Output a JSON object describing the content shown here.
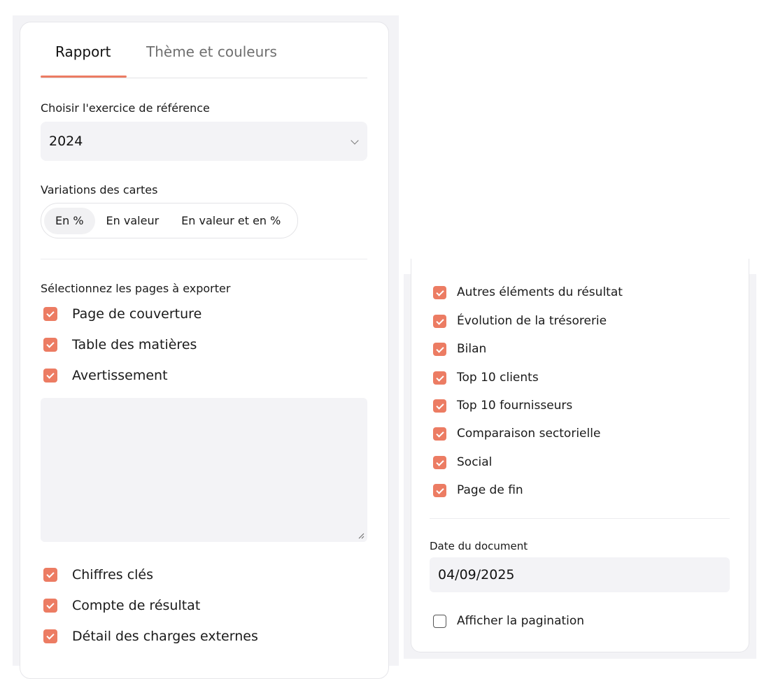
{
  "tabs": [
    {
      "label": "Rapport",
      "active": true
    },
    {
      "label": "Thème et couleurs",
      "active": false
    }
  ],
  "exercise": {
    "label": "Choisir l'exercice de référence",
    "value": "2024"
  },
  "variations": {
    "label": "Variations des cartes",
    "options": [
      "En %",
      "En valeur",
      "En valeur et en %"
    ],
    "selected": "En %"
  },
  "pages": {
    "label": "Sélectionnez les pages à exporter",
    "top": [
      {
        "label": "Page de couverture",
        "checked": true
      },
      {
        "label": "Table des matières",
        "checked": true
      },
      {
        "label": "Avertissement",
        "checked": true
      }
    ],
    "warning_text": "",
    "bottom": [
      {
        "label": "Chiffres clés",
        "checked": true
      },
      {
        "label": "Compte de résultat",
        "checked": true
      },
      {
        "label": "Détail des charges externes",
        "checked": true
      }
    ],
    "continued": [
      {
        "label": "Autres éléments du résultat",
        "checked": true
      },
      {
        "label": "Évolution de la trésorerie",
        "checked": true
      },
      {
        "label": "Bilan",
        "checked": true
      },
      {
        "label": "Top 10 clients",
        "checked": true
      },
      {
        "label": "Top 10 fournisseurs",
        "checked": true
      },
      {
        "label": "Comparaison sectorielle",
        "checked": true
      },
      {
        "label": "Social",
        "checked": true
      },
      {
        "label": "Page de fin",
        "checked": true
      }
    ]
  },
  "document_date": {
    "label": "Date du document",
    "value": "04/09/2025"
  },
  "pagination": {
    "label": "Afficher la pagination",
    "checked": false
  },
  "colors": {
    "accent": "#ec7c63",
    "field_bg": "#f3f3f6",
    "border": "#e6e6ea"
  }
}
